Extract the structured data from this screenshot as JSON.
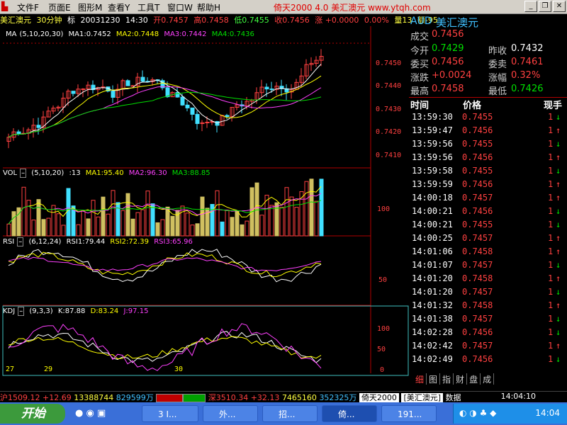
{
  "menu": {
    "items": [
      "文件F",
      "页面E",
      "图形M",
      "查看Y",
      "工具T",
      "窗口W",
      "帮助H"
    ],
    "app_title": "倚天2000 4.0 美汇澳元 www.ytqh.com"
  },
  "infoline": {
    "name": "美汇澳元",
    "period": "30分钟",
    "mark": "标",
    "date": "20031230",
    "time": "14:30",
    "open": "开0.7457",
    "high": "高0.7458",
    "low": "低0.7455",
    "close": "收0.7456",
    "change": "涨 +0.0000",
    "pct": "0.00%",
    "vol": "量13",
    "hold": "额-95"
  },
  "ma_panel": {
    "label": "MA",
    "params": "(5,10,20,30)",
    "ma1": "MA1:0.7452",
    "ma2": "MA2:0.7448",
    "ma3": "MA3:0.7442",
    "ma4": "MA4:0.7436",
    "yticks": [
      "0.7450",
      "0.7440",
      "0.7430",
      "0.7420",
      "0.7410"
    ]
  },
  "vol_panel": {
    "label": "VOL",
    "params": "(5,10,20)",
    "cur": ":13",
    "ma1": "MA1:95.40",
    "ma2": "MA2:96.30",
    "ma3": "MA3:88.85",
    "ytick": "100"
  },
  "rsi_panel": {
    "label": "RSI",
    "params": "(6,12,24)",
    "r1": "RSI1:79.44",
    "r2": "RSI2:72.39",
    "r3": "RSI3:65.96",
    "ytick": "50"
  },
  "kdj_panel": {
    "label": "KDJ",
    "params": "(9,3,3)",
    "k": "K:87.88",
    "d": "D:83.24",
    "j": "J:97.15",
    "yticks": [
      "100",
      "50",
      "0"
    ],
    "marks": [
      "27",
      "29",
      "30"
    ]
  },
  "quote": {
    "code": "AUD",
    "name": "美汇澳元",
    "last_label": "成交",
    "last": "0.7456",
    "open_label": "今开",
    "open": "0.7429",
    "prev_label": "昨收",
    "prev": "0.7432",
    "bid_label": "委买",
    "bid": "0.7456",
    "ask_label": "委卖",
    "ask": "0.7461",
    "chg_label": "涨跌",
    "chg": "+0.0024",
    "pct_label": "涨幅",
    "pct": "0.32%",
    "hi_label": "最高",
    "hi": "0.7458",
    "lo_label": "最低",
    "lo": "0.7426",
    "col_time": "时间",
    "col_price": "价格",
    "col_vol": "现手",
    "ticks": [
      {
        "t": "13:59:30",
        "p": "0.7455",
        "v": "1",
        "dir": "down"
      },
      {
        "t": "13:59:47",
        "p": "0.7456",
        "v": "1",
        "dir": "up"
      },
      {
        "t": "13:59:56",
        "p": "0.7455",
        "v": "1",
        "dir": "down"
      },
      {
        "t": "13:59:56",
        "p": "0.7456",
        "v": "1",
        "dir": "up"
      },
      {
        "t": "13:59:58",
        "p": "0.7455",
        "v": "1",
        "dir": "down"
      },
      {
        "t": "13:59:59",
        "p": "0.7456",
        "v": "1",
        "dir": "up"
      },
      {
        "t": "14:00:18",
        "p": "0.7457",
        "v": "1",
        "dir": "up"
      },
      {
        "t": "14:00:21",
        "p": "0.7456",
        "v": "1",
        "dir": "down"
      },
      {
        "t": "14:00:21",
        "p": "0.7455",
        "v": "1",
        "dir": "down"
      },
      {
        "t": "14:00:25",
        "p": "0.7457",
        "v": "1",
        "dir": "up"
      },
      {
        "t": "14:01:06",
        "p": "0.7458",
        "v": "1",
        "dir": "up"
      },
      {
        "t": "14:01:07",
        "p": "0.7457",
        "v": "1",
        "dir": "down"
      },
      {
        "t": "14:01:20",
        "p": "0.7458",
        "v": "1",
        "dir": "up"
      },
      {
        "t": "14:01:20",
        "p": "0.7457",
        "v": "1",
        "dir": "down"
      },
      {
        "t": "14:01:32",
        "p": "0.7458",
        "v": "1",
        "dir": "up"
      },
      {
        "t": "14:01:38",
        "p": "0.7457",
        "v": "1",
        "dir": "down"
      },
      {
        "t": "14:02:28",
        "p": "0.7456",
        "v": "1",
        "dir": "down"
      },
      {
        "t": "14:02:42",
        "p": "0.7457",
        "v": "1",
        "dir": "up"
      },
      {
        "t": "14:02:49",
        "p": "0.7456",
        "v": "1",
        "dir": "down"
      }
    ],
    "tabs": [
      "细",
      "图",
      "指",
      "财",
      "盘",
      "成"
    ]
  },
  "statusbar": {
    "sh": "沪1509.12",
    "sh_chg": "+12.69",
    "sh_vol": "13388744",
    "sh_amt": "829599万",
    "sz": "深3510.34",
    "sz_chg": "+32.13",
    "sz_vol": "7465160",
    "sz_amt": "352325万",
    "app": "倚天2000",
    "window": "[美汇澳元]",
    "data": "数据",
    "time": "14:04:10"
  },
  "taskbar": {
    "start": "开始",
    "buttons": [
      "3 I...",
      "外...",
      "招...",
      "倚...",
      "191..."
    ],
    "clock": "14:04"
  },
  "colors": {
    "up": "#ff4040",
    "down": "#00e000",
    "ma1": "#ffffff",
    "ma2": "#ffff00",
    "ma3": "#ff40ff",
    "ma4": "#00e000",
    "cyan": "#40e0ff"
  }
}
